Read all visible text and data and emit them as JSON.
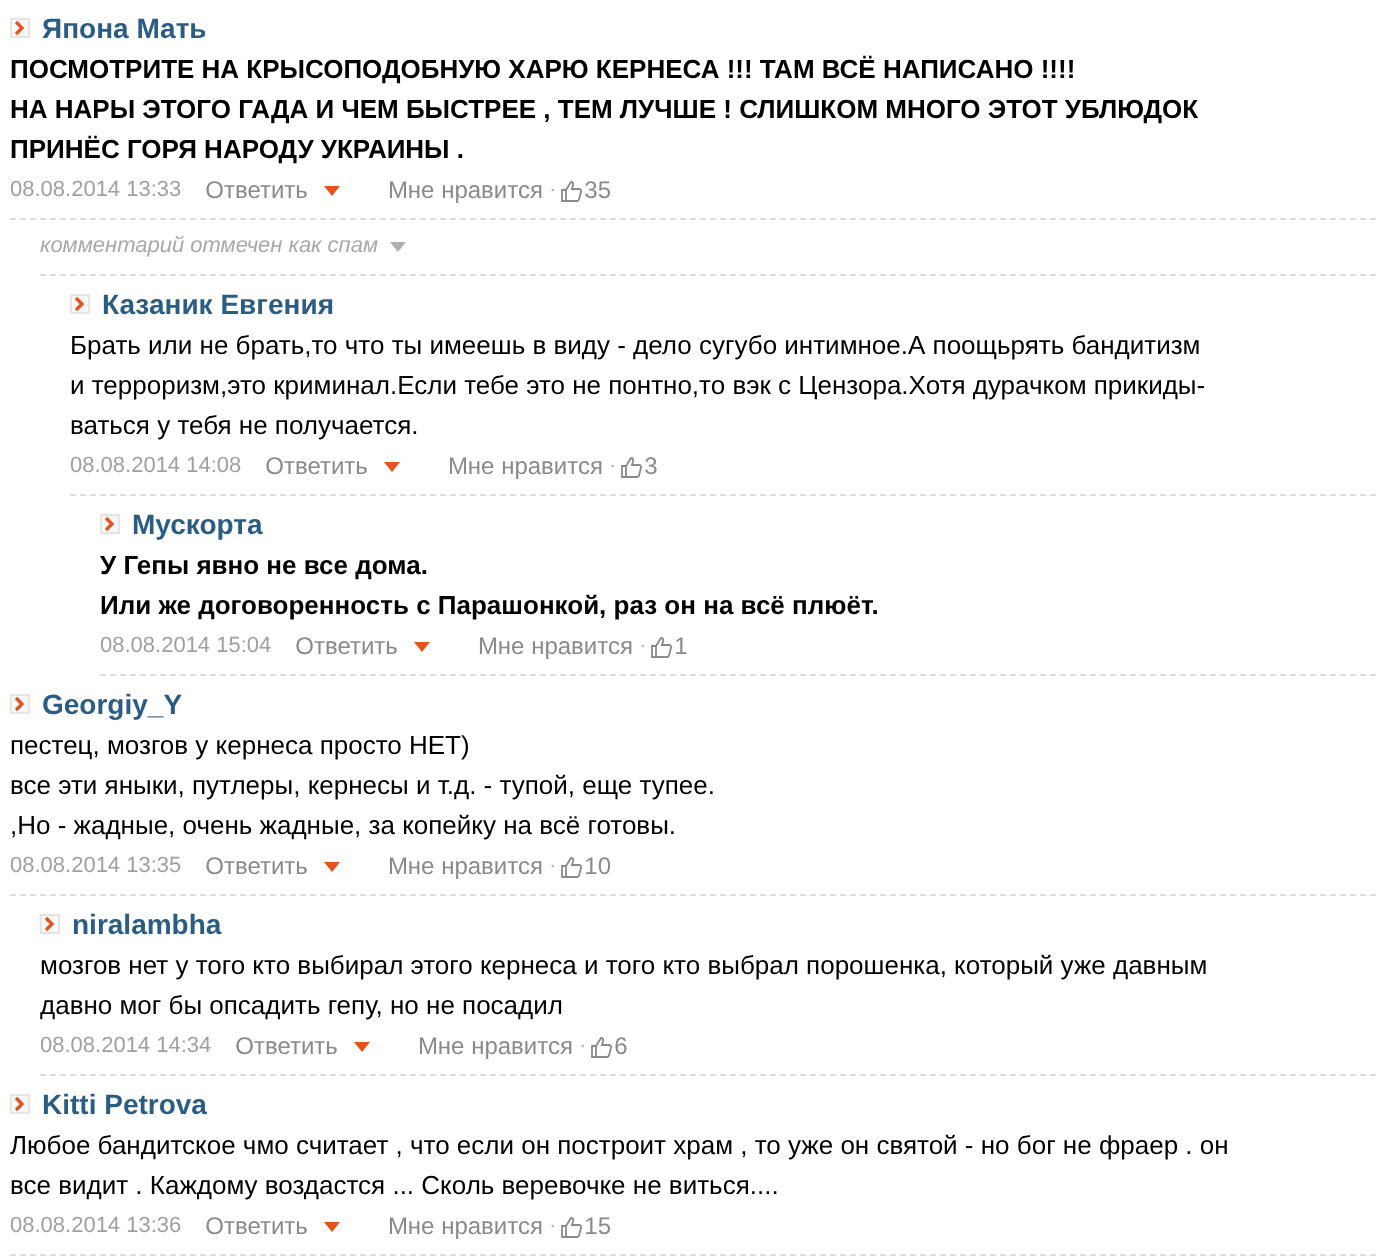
{
  "comments": [
    {
      "kind": "comment",
      "author": "Япона Мать",
      "bold": true,
      "lines": [
        "ПОСМОТРИТЕ НА КРЫСОПОДОБНУЮ ХАРЮ КЕРНЕСА !!! ТАМ ВСЁ НАПИСАНО !!!!",
        "НА НАРЫ ЭТОГО ГАДА И ЧЕМ БЫСТРЕЕ , ТЕМ ЛУЧШЕ ! СЛИШКОМ МНОГО ЭТОТ УБЛЮДОК",
        "ПРИНЁС ГОРЯ НАРОДУ УКРАИНЫ ."
      ],
      "date": "08.08.2014 13:33",
      "reply": "Ответить",
      "like": "Мне нравится",
      "dot": "·",
      "likes": "35",
      "children": [
        {
          "kind": "spam",
          "notice": "комментарий отмечен как спам",
          "children": [
            {
              "kind": "comment",
              "author": "Казаник Евгения",
              "bold": false,
              "lines": [
                "Брать или не брать,то что ты имеешь в виду - дело сугубо интимное.А поощьрять бандитизм",
                "и терроризм,это криминал.Если тебе это не понтно,то вэк с Цензора.Хотя дурачком прикиды-",
                "ваться у тебя не получается."
              ],
              "date": "08.08.2014 14:08",
              "reply": "Ответить",
              "like": "Мне нравится",
              "dot": "·",
              "likes": "3",
              "children": [
                {
                  "kind": "comment",
                  "author": "Мускорта",
                  "bold": true,
                  "lines": [
                    "У Гепы явно не все дома.",
                    "Или же договоренность с Парашонкой, раз он на всё плюёт."
                  ],
                  "date": "08.08.2014 15:04",
                  "reply": "Ответить",
                  "like": "Мне нравится",
                  "dot": "·",
                  "likes": "1"
                }
              ]
            }
          ]
        }
      ]
    },
    {
      "kind": "comment",
      "author": "Georgiy_Y",
      "bold": false,
      "lines": [
        "пестец, мозгов у кернеса просто НЕТ)",
        "все эти яныки, путлеры, кернесы и т.д. - тупой, еще тупее.",
        ",Но - жадные, очень жадные, за копейку на всё готовы."
      ],
      "date": "08.08.2014 13:35",
      "reply": "Ответить",
      "like": "Мне нравится",
      "dot": "·",
      "likes": "10",
      "children": [
        {
          "kind": "comment",
          "author": "niralambha",
          "bold": false,
          "lines": [
            "мозгов нет у того кто выбирал этого кернеса и того кто выбрал порошенка, который уже давным",
            "давно мог бы опсадить гепу, но не посадил"
          ],
          "date": "08.08.2014 14:34",
          "reply": "Ответить",
          "like": "Мне нравится",
          "dot": "·",
          "likes": "6"
        }
      ]
    },
    {
      "kind": "comment",
      "author": "Kitti Petrova",
      "bold": false,
      "lines": [
        "Любое бандитское чмо считает , что если он построит храм , то уже он святой - но бог не фраер . он",
        "все видит . Каждому воздастся ... Сколь веревочке не виться...."
      ],
      "date": "08.08.2014 13:36",
      "reply": "Ответить",
      "like": "Мне нравится",
      "dot": "·",
      "likes": "15"
    }
  ]
}
